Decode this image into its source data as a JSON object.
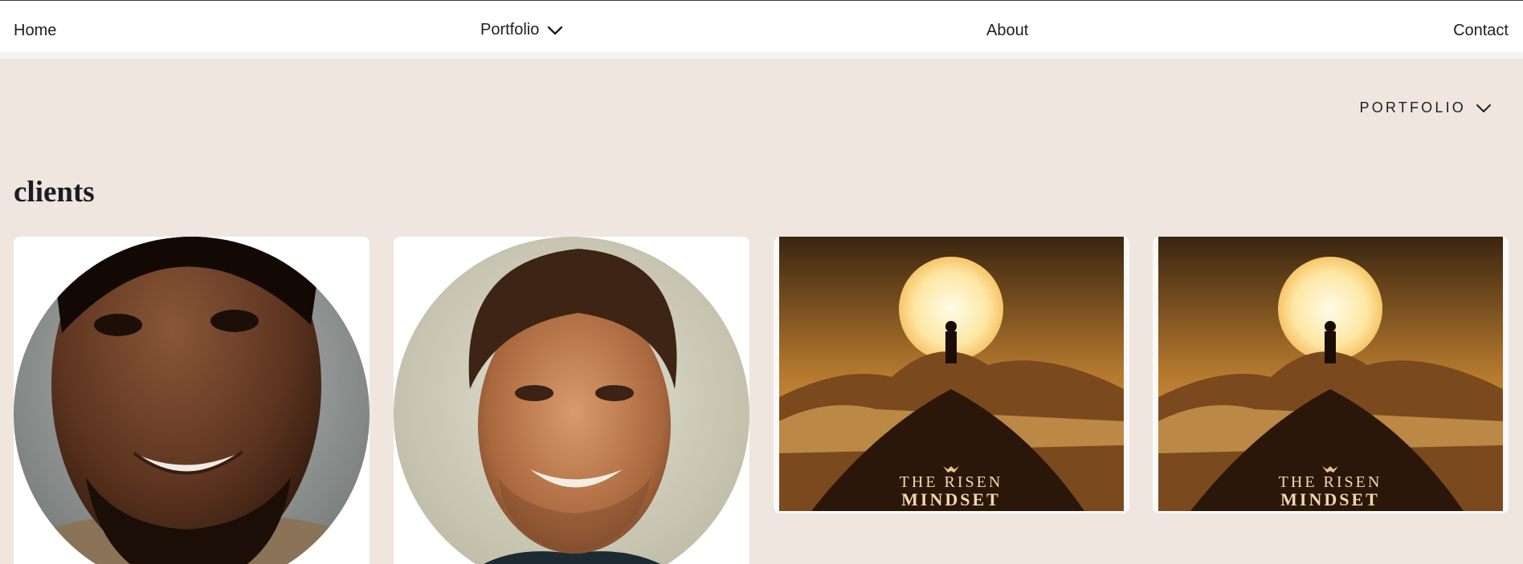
{
  "nav": {
    "home": "Home",
    "portfolio": "Portfolio",
    "about": "About",
    "contact": "Contact"
  },
  "subnav": {
    "dropdown_label": "PORTFOLIO"
  },
  "page": {
    "title": "clients"
  },
  "gallery": {
    "items": [
      {
        "type": "portrait",
        "subject": "smiling man with beard, dark skin"
      },
      {
        "type": "portrait",
        "subject": "smiling man with short brown hair"
      },
      {
        "type": "poster",
        "title_line1": "THE RISEN",
        "title_line2": "MINDSET"
      },
      {
        "type": "poster",
        "title_line1": "THE RISEN",
        "title_line2": "MINDSET"
      }
    ]
  },
  "colors": {
    "background": "#EEE6DF",
    "nav_bg": "#FFFFFF",
    "title": "#1B1D24",
    "poster_gold": "#F4C76A"
  }
}
